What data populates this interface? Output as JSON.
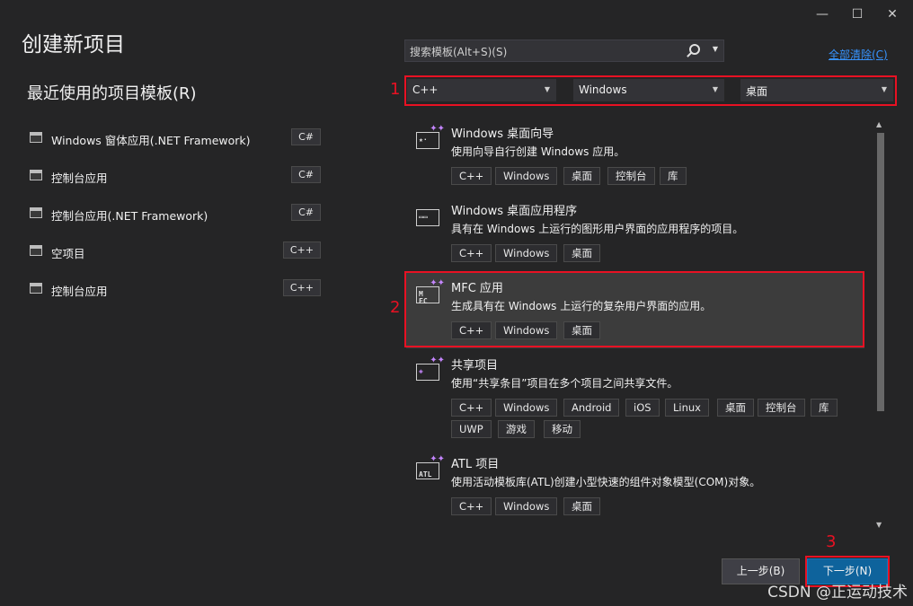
{
  "window": {
    "minimize_icon": "minimize-icon",
    "maximize_icon": "maximize-icon",
    "close_icon": "close-icon"
  },
  "page_title": "创建新项目",
  "recent": {
    "title": "最近使用的项目模板(R)",
    "items": [
      {
        "label": "Windows 窗体应用(.NET Framework)",
        "lang": "C#"
      },
      {
        "label": "控制台应用",
        "lang": "C#"
      },
      {
        "label": "控制台应用(.NET Framework)",
        "lang": "C#"
      },
      {
        "label": "空项目",
        "lang": "C++"
      },
      {
        "label": "控制台应用",
        "lang": "C++"
      }
    ]
  },
  "search": {
    "placeholder": "搜索模板(Alt+S)(S)"
  },
  "clear_all": "全部清除(C)",
  "filters": {
    "language": "C++",
    "platform": "Windows",
    "project_type": "桌面"
  },
  "annotations": {
    "one": "1",
    "two": "2",
    "three": "3"
  },
  "templates": [
    {
      "name": "Windows 桌面向导",
      "desc": "使用向导自行创建 Windows 应用。",
      "tags": [
        "C++",
        "Windows",
        "桌面",
        "控制台",
        "库"
      ]
    },
    {
      "name": "Windows 桌面应用程序",
      "desc": "具有在 Windows 上运行的图形用户界面的应用程序的项目。",
      "tags": [
        "C++",
        "Windows",
        "桌面"
      ]
    },
    {
      "name": "MFC 应用",
      "desc": "生成具有在 Windows 上运行的复杂用户界面的应用。",
      "tags": [
        "C++",
        "Windows",
        "桌面"
      ],
      "selected": true
    },
    {
      "name": "共享项目",
      "desc": "使用“共享条目”项目在多个项目之间共享文件。",
      "tags": [
        "C++",
        "Windows",
        "Android",
        "iOS",
        "Linux",
        "桌面",
        "控制台",
        "库",
        "UWP",
        "游戏",
        "移动"
      ]
    },
    {
      "name": "ATL 项目",
      "desc": "使用活动模板库(ATL)创建小型快速的组件对象模型(COM)对象。",
      "tags": [
        "C++",
        "Windows",
        "桌面"
      ]
    }
  ],
  "buttons": {
    "back": "上一步(B)",
    "next": "下一步(N)"
  },
  "watermark": "CSDN @正运动技术",
  "colors": {
    "accent": "#0e639c",
    "link": "#3794ff",
    "annotation": "#e81123"
  }
}
